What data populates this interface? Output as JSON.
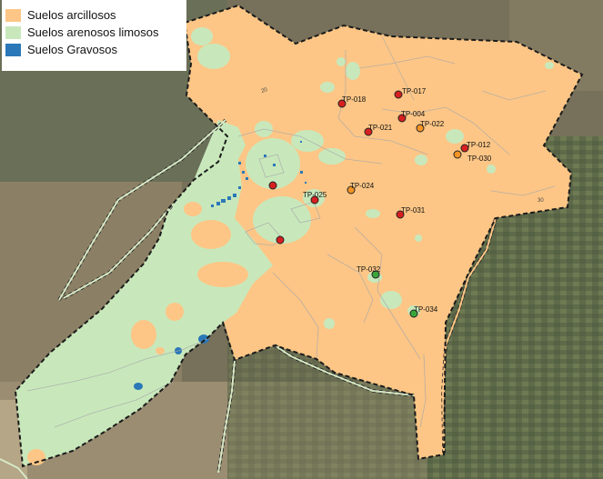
{
  "legend": {
    "items": [
      {
        "label": "Suelos arcillosos",
        "color": "#fdc686"
      },
      {
        "label": "Suelos arenosos limosos",
        "color": "#c8e8bb"
      },
      {
        "label": "Suelos Gravosos",
        "color": "#2b78b8"
      }
    ]
  },
  "colors": {
    "clay": "#fdc686",
    "sandy_silt": "#c8e8bb",
    "gravel": "#2b78b8",
    "boundary": "#1b1b1b",
    "road": "#d7e8c6",
    "point_red": "#d62020",
    "point_orange": "#f39325",
    "point_green": "#3aa53a"
  },
  "test_pits": [
    {
      "id": "TP-017",
      "label": "TP-017",
      "status": "red"
    },
    {
      "id": "TP-018",
      "label": "TP-018",
      "status": "red"
    },
    {
      "id": "TP-004",
      "label": "TP-004",
      "status": "red"
    },
    {
      "id": "TP-021",
      "label": "TP-021",
      "status": "red"
    },
    {
      "id": "TP-022",
      "label": "TP-022",
      "status": "orange"
    },
    {
      "id": "TP-012",
      "label": "TP-012",
      "status": "red"
    },
    {
      "id": "TP-030",
      "label": "TP-030",
      "status": "orange"
    },
    {
      "id": "TP-024",
      "label": "TP-024",
      "status": "orange"
    },
    {
      "id": "TP-025",
      "label": "TP-025",
      "status": "red"
    },
    {
      "id": "TP-031",
      "label": "TP-031",
      "status": "red"
    },
    {
      "id": "TP-032",
      "label": "TP-032",
      "status": "green"
    },
    {
      "id": "TP-034",
      "label": "TP-034",
      "status": "green"
    }
  ],
  "road_labels": [
    "20",
    "30"
  ]
}
